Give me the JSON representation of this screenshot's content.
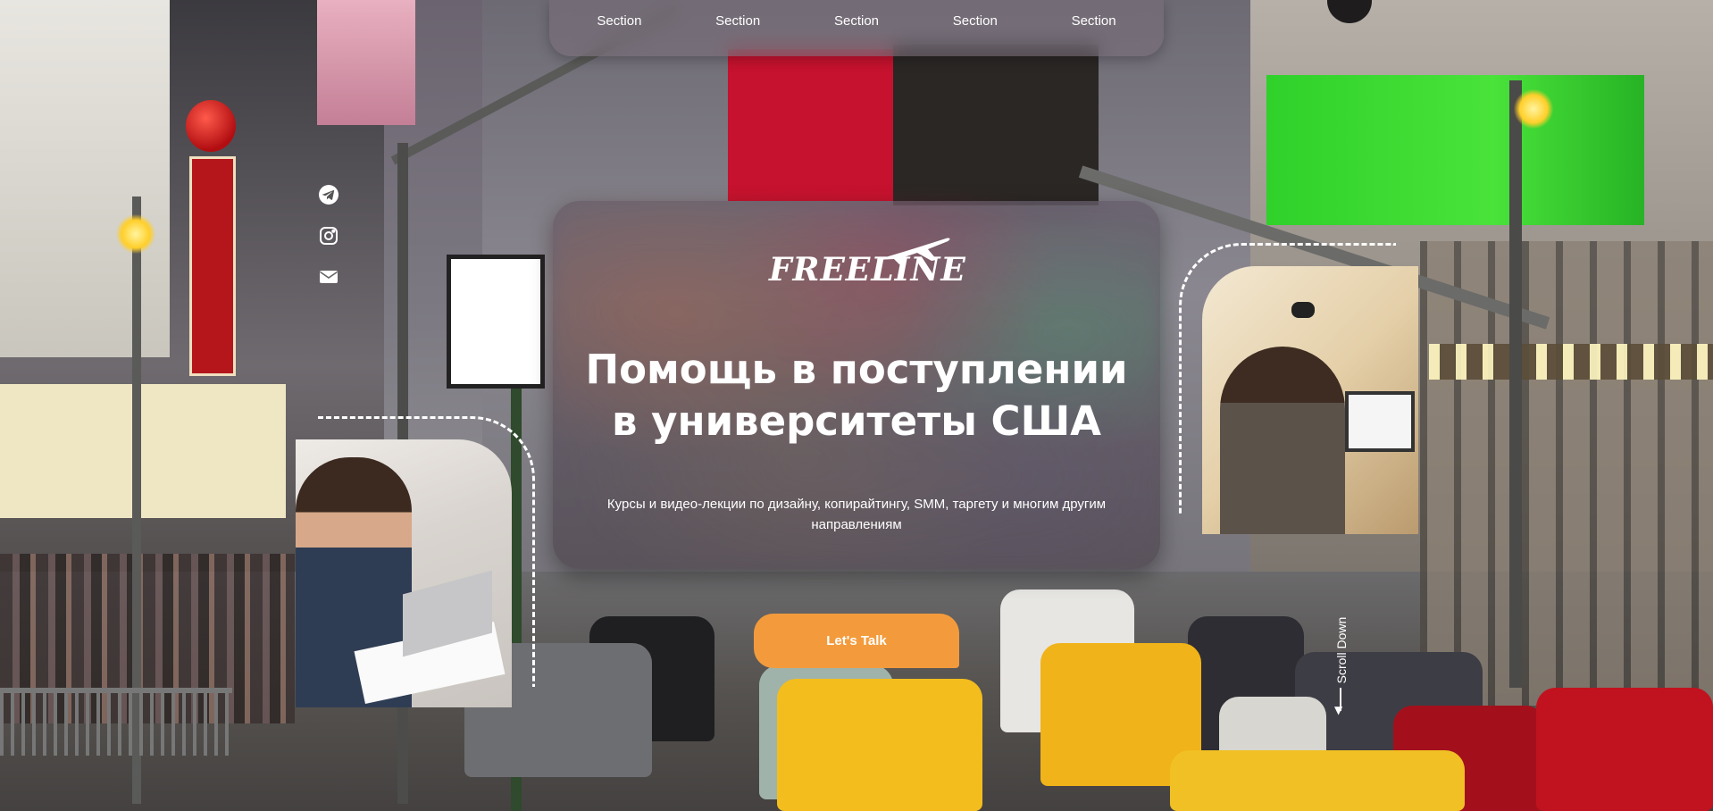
{
  "nav": {
    "items": [
      "Section",
      "Section",
      "Section",
      "Section",
      "Section"
    ]
  },
  "social": [
    {
      "icon": "telegram-icon"
    },
    {
      "icon": "instagram-icon"
    },
    {
      "icon": "mail-icon"
    }
  ],
  "hero": {
    "logo_text": "FREELINE",
    "title_line1": "Помощь в поступлении",
    "title_line2": "в университеты США",
    "subtitle": "Курсы и видео-лекции по дизайну, копирайтингу, SMM, таргету и многим другим направлениям"
  },
  "cta": {
    "label": "Let's Talk"
  },
  "scroll": {
    "label": "Scroll Down"
  },
  "colors": {
    "accent": "#f39b3c",
    "text": "#ffffff"
  }
}
